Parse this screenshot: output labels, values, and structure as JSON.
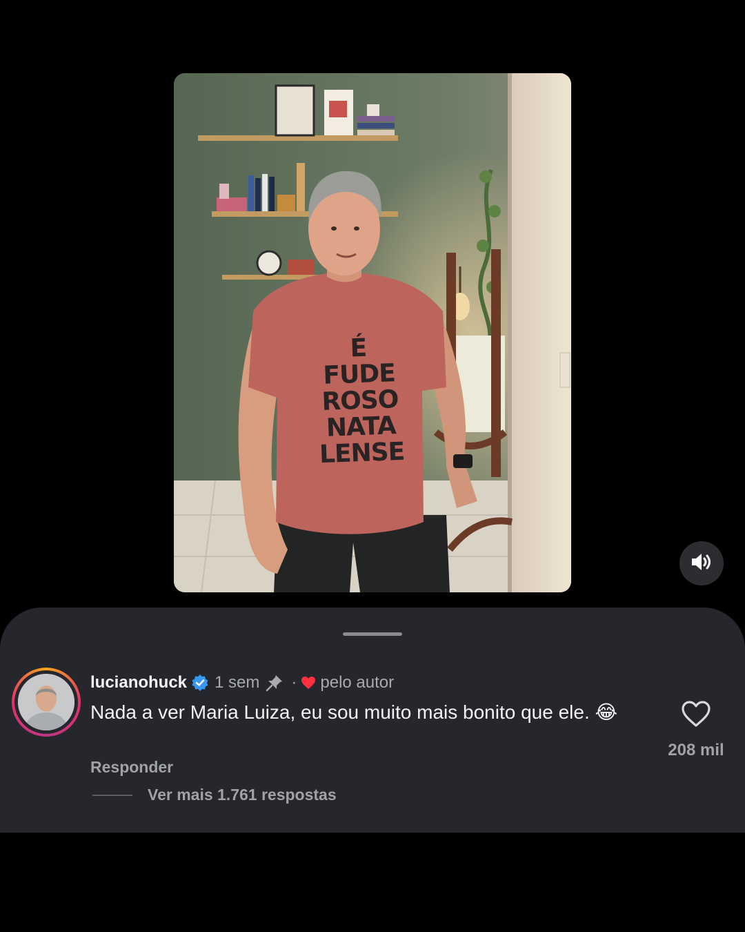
{
  "video": {
    "shirt_text": "É\nFUDE\nROSO\nNATA\nLENSE"
  },
  "controls": {
    "sound_icon": "speaker-on-icon"
  },
  "comment": {
    "username": "lucianohuck",
    "verified_icon": "verified-badge-icon",
    "time": "1 sem",
    "pin_icon": "pin-icon",
    "separator": "·",
    "liked_by_author_icon": "red-heart-icon",
    "liked_by_author_label": "pelo autor",
    "text": "Nada a ver Maria Luiza, eu sou muito mais bonito que ele.",
    "emoji": "😂",
    "reply_label": "Responder",
    "view_more_label": "Ver mais 1.761 respostas",
    "like_count": "208 mil",
    "like_icon": "heart-outline-icon"
  },
  "colors": {
    "sheet_bg": "#25272c",
    "verified_blue": "#3897f0",
    "heart_red": "#ff3040",
    "muted_text": "#a0a2a6"
  }
}
